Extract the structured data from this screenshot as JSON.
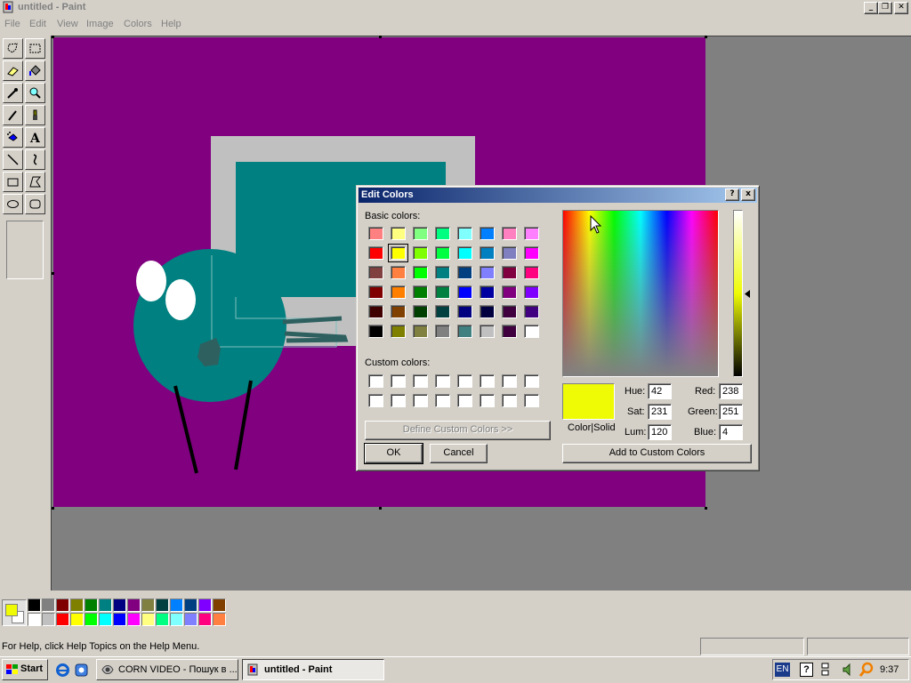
{
  "window": {
    "title": "untitled - Paint"
  },
  "menu": [
    "File",
    "Edit",
    "View",
    "Image",
    "Colors",
    "Help"
  ],
  "tools": [
    "free-form-select",
    "select",
    "eraser",
    "fill-with-color",
    "pick-color",
    "magnifier",
    "pencil",
    "brush",
    "airbrush",
    "text",
    "line",
    "curve",
    "rectangle",
    "polygon",
    "ellipse",
    "rounded-rectangle"
  ],
  "colors": {
    "foreground": "#eefb04",
    "background": "#ffffff",
    "canvas": "#800080"
  },
  "palette": [
    [
      "#000000",
      "#808080",
      "#800000",
      "#808000",
      "#008000",
      "#008080",
      "#000080",
      "#800080",
      "#808040",
      "#004040",
      "#0080ff",
      "#004080",
      "#8000ff",
      "#804000"
    ],
    [
      "#ffffff",
      "#c0c0c0",
      "#ff0000",
      "#ffff00",
      "#00ff00",
      "#00ffff",
      "#0000ff",
      "#ff00ff",
      "#ffff80",
      "#00ff80",
      "#80ffff",
      "#8080ff",
      "#ff0080",
      "#ff8040"
    ]
  ],
  "statusbar": {
    "help_text": "For Help, click Help Topics on the Help Menu."
  },
  "taskbar": {
    "start_label": "Start",
    "tasks": [
      {
        "label": "CORN VIDEO - Пошук в ...",
        "active": false
      },
      {
        "label": "untitled - Paint",
        "active": true
      }
    ],
    "tray": {
      "language": "EN",
      "time": "9:37"
    }
  },
  "dialog": {
    "title": "Edit Colors",
    "basic_colors_label": "Basic colors:",
    "basic_colors": [
      [
        "#ff8080",
        "#ffff80",
        "#80ff80",
        "#00ff80",
        "#80ffff",
        "#0080ff",
        "#ff80c0",
        "#ff80ff"
      ],
      [
        "#ff0000",
        "#ffff00",
        "#80ff00",
        "#00ff40",
        "#00ffff",
        "#0080c0",
        "#8080c0",
        "#ff00ff"
      ],
      [
        "#804040",
        "#ff8040",
        "#00ff00",
        "#008080",
        "#004080",
        "#8080ff",
        "#800040",
        "#ff0080"
      ],
      [
        "#800000",
        "#ff8000",
        "#008000",
        "#008040",
        "#0000ff",
        "#0000a0",
        "#800080",
        "#8000ff"
      ],
      [
        "#400000",
        "#804000",
        "#004000",
        "#004040",
        "#000080",
        "#000040",
        "#400040",
        "#400080"
      ],
      [
        "#000000",
        "#808000",
        "#808040",
        "#808080",
        "#408080",
        "#c0c0c0",
        "#400040",
        "#ffffff"
      ]
    ],
    "selected_basic": "1-1",
    "custom_colors_label": "Custom colors:",
    "custom_colors": [
      [
        "#ffffff",
        "#ffffff",
        "#ffffff",
        "#ffffff",
        "#ffffff",
        "#ffffff",
        "#ffffff",
        "#ffffff"
      ],
      [
        "#ffffff",
        "#ffffff",
        "#ffffff",
        "#ffffff",
        "#ffffff",
        "#ffffff",
        "#ffffff",
        "#ffffff"
      ]
    ],
    "define_custom_label": "Define Custom Colors >>",
    "ok_label": "OK",
    "cancel_label": "Cancel",
    "add_custom_label": "Add to Custom Colors",
    "color_solid_label": "Color|Solid",
    "color_solid_value": "#eefb04",
    "fields": {
      "hue_label": "Hue:",
      "hue": "42",
      "sat_label": "Sat:",
      "sat": "231",
      "lum_label": "Lum:",
      "lum": "120",
      "red_label": "Red:",
      "red": "238",
      "green_label": "Green:",
      "green": "251",
      "blue_label": "Blue:",
      "blue": "4"
    },
    "help_button": "?",
    "close_button": "x"
  }
}
